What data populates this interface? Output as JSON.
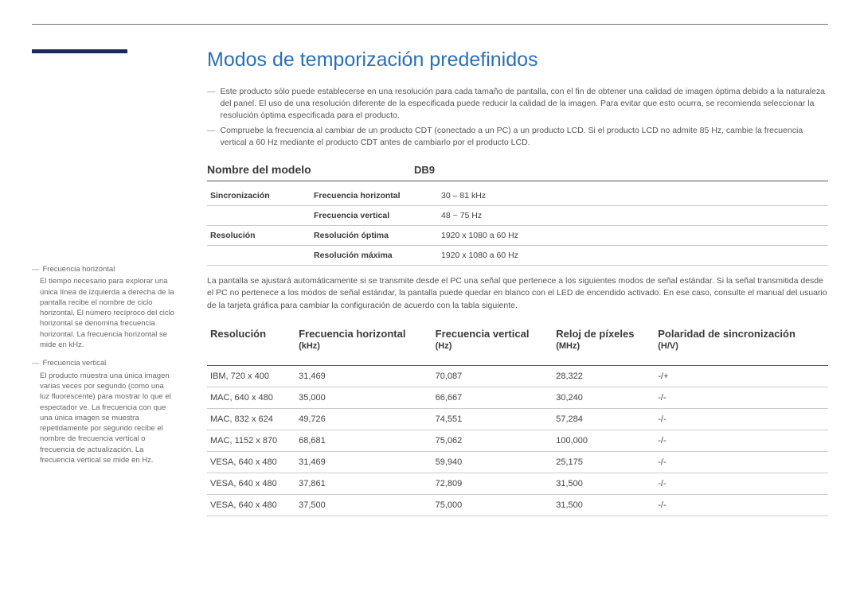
{
  "title": "Modos de temporización predefinidos",
  "notes": [
    "Este producto sólo puede establecerse en una resolución para cada tamaño de pantalla, con el fin de obtener una calidad de imagen óptima debido a la naturaleza del panel. El uso de una resolución diferente de la especificada puede reducir la calidad de la imagen. Para evitar que esto ocurra, se recomienda seleccionar la resolución óptima especificada para el producto.",
    "Compruebe la frecuencia al cambiar de un producto CDT (conectado a un PC) a un producto LCD. Si el producto LCD no admite 85 Hz, cambie la frecuencia vertical a 60 Hz mediante el producto CDT antes de cambiarlo por el producto LCD."
  ],
  "model": {
    "label": "Nombre del modelo",
    "value": "DB9"
  },
  "spec": {
    "rows": [
      {
        "group": "Sincronización",
        "label": "Frecuencia horizontal",
        "value": "30 – 81 kHz"
      },
      {
        "group": "",
        "label": "Frecuencia vertical",
        "value": "48 ~ 75 Hz"
      },
      {
        "group": "Resolución",
        "label": "Resolución óptima",
        "value": "1920 x 1080 a 60 Hz"
      },
      {
        "group": "",
        "label": "Resolución máxima",
        "value": "1920 x 1080 a 60 Hz"
      }
    ]
  },
  "para": "La pantalla se ajustará automáticamente si se transmite desde el PC una señal que pertenece a los siguientes modos de señal estándar. Si la señal transmitida desde el PC no pertenece a los modos de señal estándar, la pantalla puede quedar en blanco con el LED de encendido activado. En ese caso, consulte el manual del usuario de la tarjeta gráfica para cambiar la configuración de acuerdo con la tabla siguiente.",
  "columns": [
    {
      "head": "Resolución",
      "sub": ""
    },
    {
      "head": "Frecuencia horizontal",
      "sub": "(kHz)"
    },
    {
      "head": "Frecuencia vertical",
      "sub": "(Hz)"
    },
    {
      "head": "Reloj de píxeles",
      "sub": "(MHz)"
    },
    {
      "head": "Polaridad de sincronización",
      "sub": "(H/V)"
    }
  ],
  "rows": [
    {
      "c0": "IBM, 720 x 400",
      "c1": "31,469",
      "c2": "70,087",
      "c3": "28,322",
      "c4": "-/+"
    },
    {
      "c0": "MAC, 640 x 480",
      "c1": "35,000",
      "c2": "66,667",
      "c3": "30,240",
      "c4": "-/-"
    },
    {
      "c0": "MAC, 832 x 624",
      "c1": "49,726",
      "c2": "74,551",
      "c3": "57,284",
      "c4": "-/-"
    },
    {
      "c0": "MAC, 1152 x 870",
      "c1": "68,681",
      "c2": "75,062",
      "c3": "100,000",
      "c4": "-/-"
    },
    {
      "c0": "VESA, 640 x 480",
      "c1": "31,469",
      "c2": "59,940",
      "c3": "25,175",
      "c4": "-/-"
    },
    {
      "c0": "VESA, 640 x 480",
      "c1": "37,861",
      "c2": "72,809",
      "c3": "31,500",
      "c4": "-/-"
    },
    {
      "c0": "VESA, 640 x 480",
      "c1": "37,500",
      "c2": "75,000",
      "c3": "31,500",
      "c4": "-/-"
    }
  ],
  "sidebar": {
    "items": [
      {
        "term": "Frecuencia horizontal",
        "def": "El tiempo necesario para explorar una única línea de izquierda a derecha de la pantalla recibe el nombre de ciclo horizontal. El número recíproco del ciclo horizontal se denomina frecuencia horizontal. La frecuencia horizontal se mide en kHz."
      },
      {
        "term": "Frecuencia vertical",
        "def": "El producto muestra una única imagen varias veces por segundo (como una luz fluorescente) para mostrar lo que el espectador ve. La frecuencia con que una única imagen se muestra repetidamente por segundo recibe el nombre de frecuencia vertical o frecuencia de actualización. La frecuencia vertical se mide en Hz."
      }
    ]
  }
}
